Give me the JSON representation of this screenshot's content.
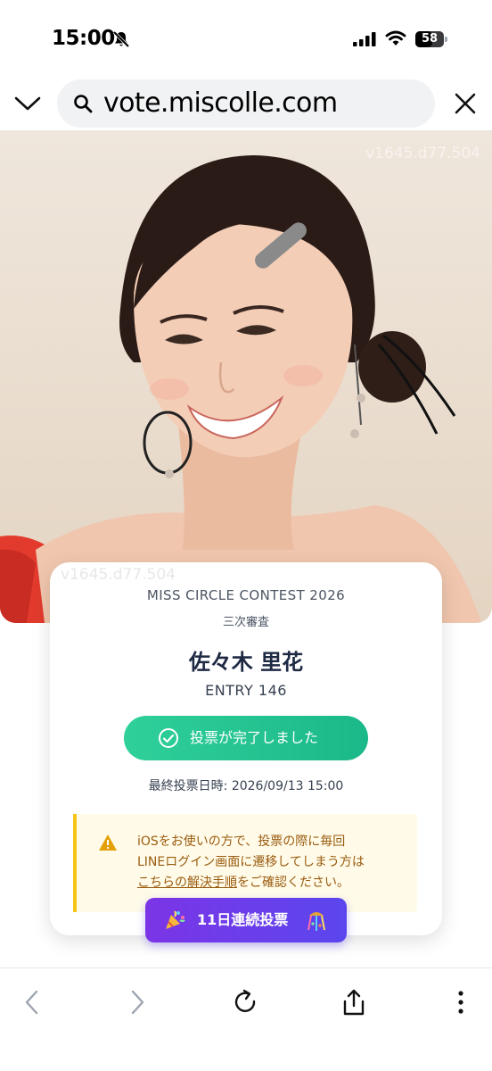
{
  "status_bar": {
    "time": "15:00",
    "battery_level": "58",
    "icons": [
      "bell-muted-icon",
      "signal-icon",
      "wifi-icon",
      "battery-icon"
    ]
  },
  "browser": {
    "url": "vote.miscolle.com",
    "collapse_icon": "chevron-down-icon",
    "search_icon": "search-icon",
    "close_icon": "close-icon"
  },
  "hero": {
    "watermark": "v1645.d77.504"
  },
  "card": {
    "watermark": "v1645.d77.504",
    "contest": "MISS CIRCLE CONTEST 2026",
    "stage": "三次審査",
    "name": "佐々木 里花",
    "entry": "ENTRY 146",
    "vote_button_label": "投票が完了しました",
    "last_vote": "最終投票日時: 2026/09/13 15:00",
    "notice": {
      "line1": "iOSをお使いの方で、投票の際に毎回",
      "line2": "LINEログイン画面に遷移してしまう方は",
      "link": "こちらの解決手順",
      "line3_rest": "をご確認ください。"
    },
    "streak_label": "11日連続投票"
  },
  "colors": {
    "vote_green": "#1bb889",
    "streak_purple": "#6a3de9",
    "notice_bg": "#fffbe8",
    "notice_border": "#f5c518",
    "notice_text": "#9a5b0f"
  },
  "toolbar": {
    "icons": [
      "back-icon",
      "forward-icon",
      "reload-icon",
      "share-icon",
      "more-icon"
    ]
  }
}
